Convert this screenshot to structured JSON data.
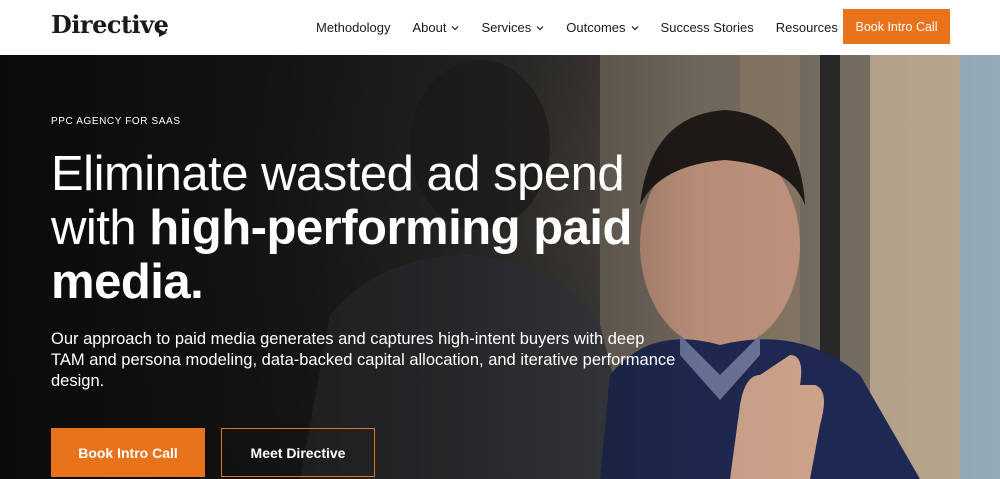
{
  "header": {
    "logo_text": "Directive",
    "nav": [
      {
        "label": "Methodology",
        "has_dropdown": false
      },
      {
        "label": "About",
        "has_dropdown": true
      },
      {
        "label": "Services",
        "has_dropdown": true
      },
      {
        "label": "Outcomes",
        "has_dropdown": true
      },
      {
        "label": "Success Stories",
        "has_dropdown": false
      },
      {
        "label": "Resources",
        "has_dropdown": true
      }
    ],
    "cta_label": "Book Intro Call"
  },
  "hero": {
    "eyebrow": "PPC AGENCY FOR SAAS",
    "headline_light": "Eliminate wasted ad spend with ",
    "headline_bold": "high-performing paid media.",
    "subcopy": "Our approach to paid media generates and captures high-intent buyers with deep TAM and persona modeling, data-backed capital allocation, and iterative performance design.",
    "primary_button": "Book Intro Call",
    "secondary_button": "Meet Directive"
  },
  "colors": {
    "accent": "#e8731a",
    "text_dark": "#1a1a1a",
    "hero_text": "#ffffff"
  }
}
